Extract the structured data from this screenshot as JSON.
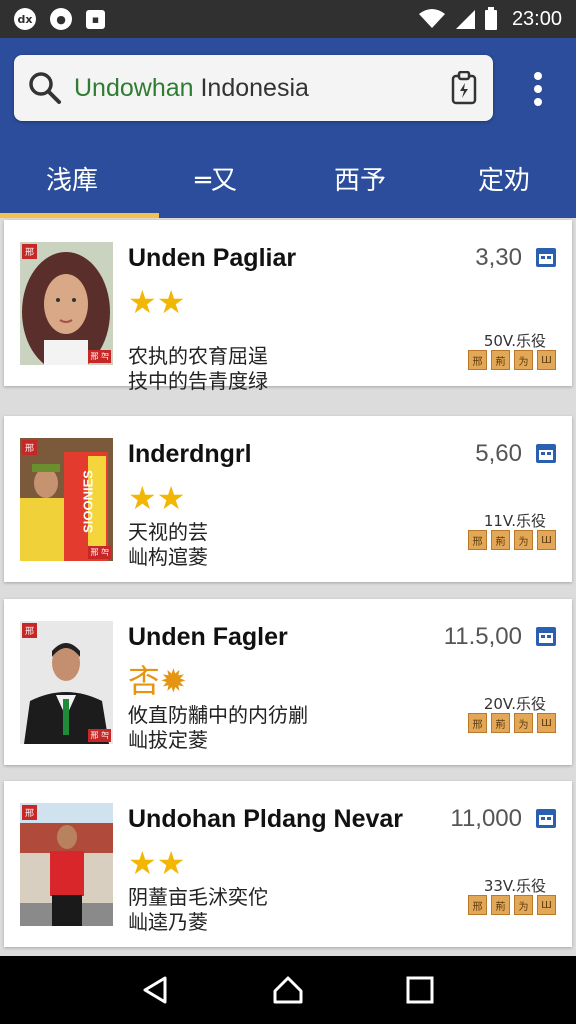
{
  "status_bar": {
    "left_icons": [
      "dx-icon",
      "camera-icon",
      "square-notification-icon"
    ],
    "time": "23:00"
  },
  "search": {
    "value_highlight": "Undowhan",
    "value_rest": " Indonesia"
  },
  "tabs": [
    {
      "label": "浅㢑",
      "active": true
    },
    {
      "label": "═又",
      "active": false
    },
    {
      "label": "西予",
      "active": false
    },
    {
      "label": "定劝",
      "active": false
    }
  ],
  "cards": [
    {
      "title": "Unden Pagliar",
      "price": "3,30",
      "stars": "★★",
      "desc_line1": "农执的农育屈逞",
      "desc_line2": "技中的告青度绿",
      "meta": "50V.乐役",
      "chips": [
        "邢",
        "荊",
        "为",
        "Ш"
      ],
      "thumb_badge": "邢",
      "thumb_corner": "邢 㔖"
    },
    {
      "title": "Inderdngrl",
      "price": "5,60",
      "stars": "★★",
      "desc_line1": "天视的芸",
      "desc_line2": "屾构逭菱",
      "meta": "11V.乐役",
      "chips": [
        "邢",
        "荊",
        "为",
        "Ш"
      ],
      "thumb_badge": "邢",
      "thumb_corner": "邢 㔖",
      "thumb_banner": "SIOONIES"
    },
    {
      "title": "Unden Fagler",
      "price": "11.5,00",
      "stars": "㕻✹",
      "desc_line1": "攸直防黼中的内彷剻",
      "desc_line2": "屾拔定菱",
      "meta": "20V.乐役",
      "chips": [
        "邢",
        "荊",
        "为",
        "Ш"
      ],
      "thumb_badge": "邢",
      "thumb_corner": "邢 㔖"
    },
    {
      "title": "Undohan Pldang Nevar",
      "price": "11,000",
      "stars": "★★",
      "desc_line1": "阴蕫亩毛沭奕佗",
      "desc_line2": "屾逵乃菱",
      "meta": "33V.乐役",
      "chips": [
        "邢",
        "荊",
        "为",
        "Ш"
      ],
      "thumb_badge": "邢",
      "thumb_corner": ""
    }
  ],
  "colors": {
    "app_bar": "#2b4d9b",
    "tab_indicator": "#f2c14e",
    "star": "#f2b705",
    "highlight_text": "#2e7d32"
  }
}
